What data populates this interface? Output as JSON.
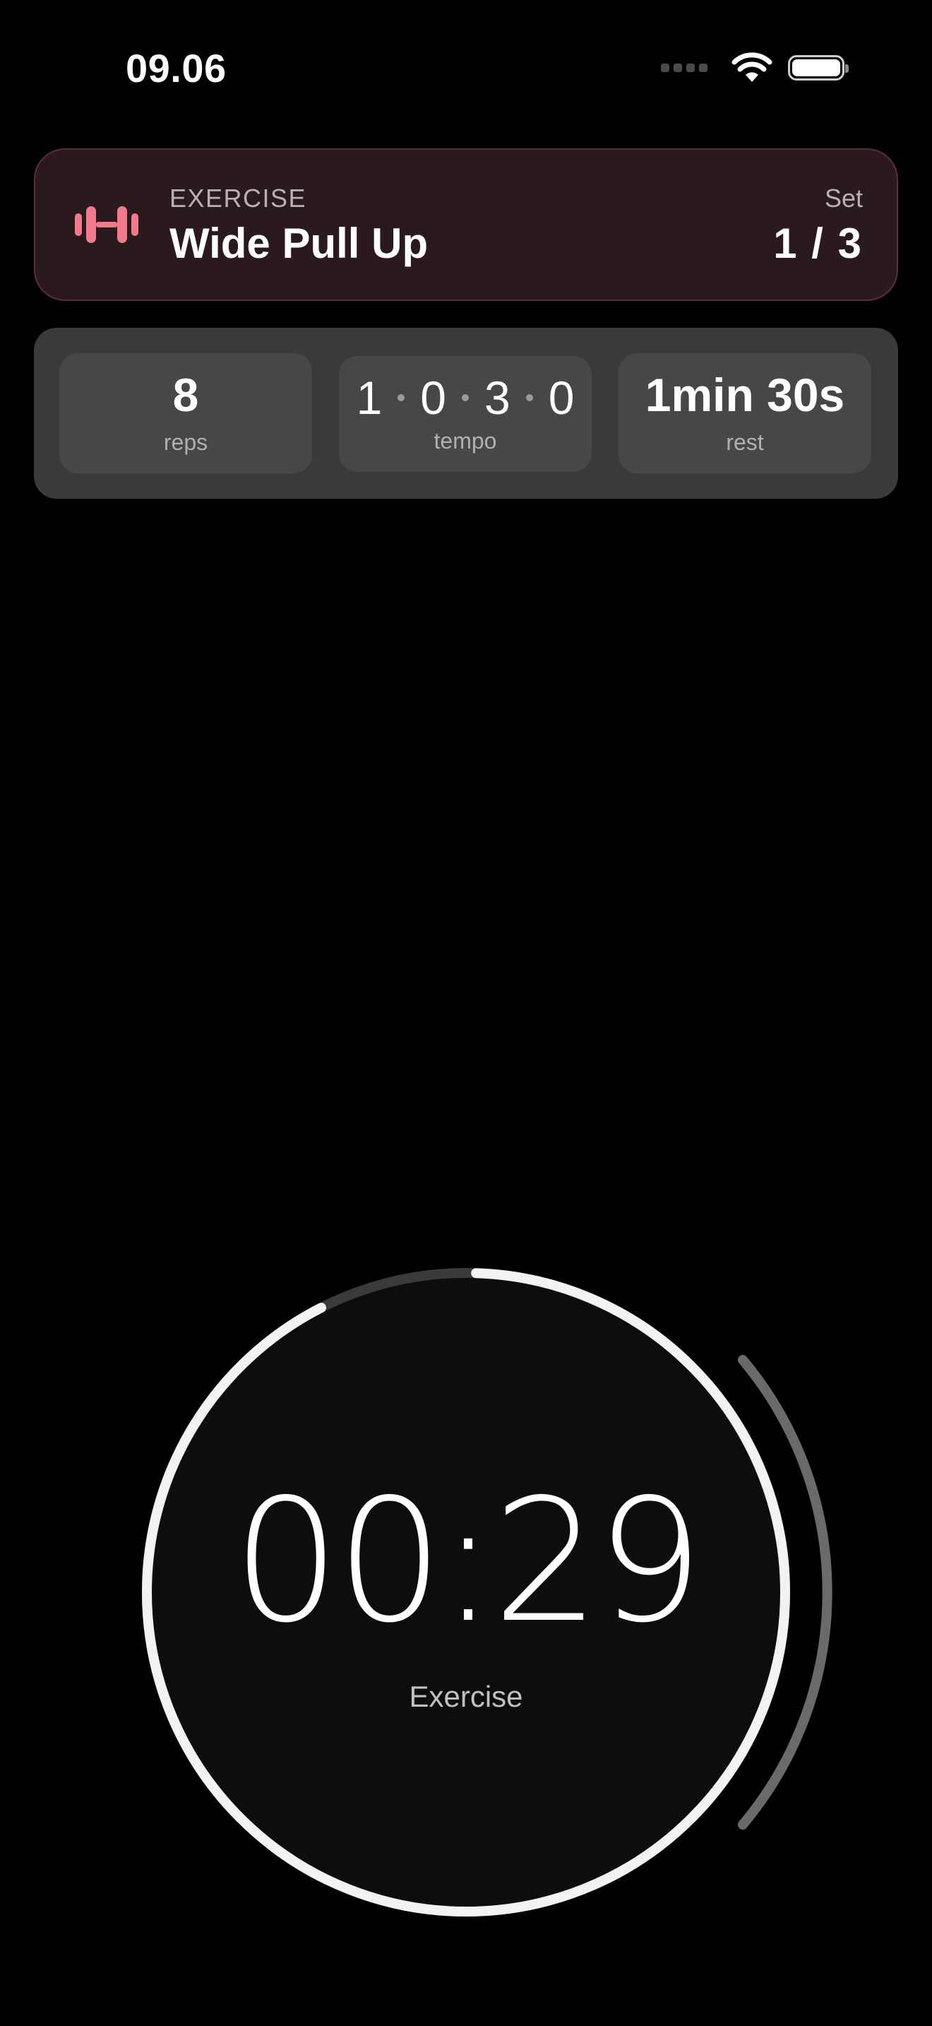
{
  "status_bar": {
    "time": "09.06"
  },
  "exercise": {
    "kicker": "EXERCISE",
    "name": "Wide Pull Up",
    "set_label": "Set",
    "set_value": "1 / 3",
    "accent_color": "#f07a8c"
  },
  "stats": {
    "reps": {
      "value": "8",
      "label": "reps"
    },
    "tempo": {
      "digits": [
        "1",
        "0",
        "3",
        "0"
      ],
      "label": "tempo"
    },
    "rest": {
      "value": "1min 30s",
      "label": "rest"
    }
  },
  "timer": {
    "time": "00:29",
    "phase": "Exercise",
    "progress_fraction": 0.92,
    "ring_color": "#f2f2f2",
    "track_color": "#3a3a3a"
  }
}
